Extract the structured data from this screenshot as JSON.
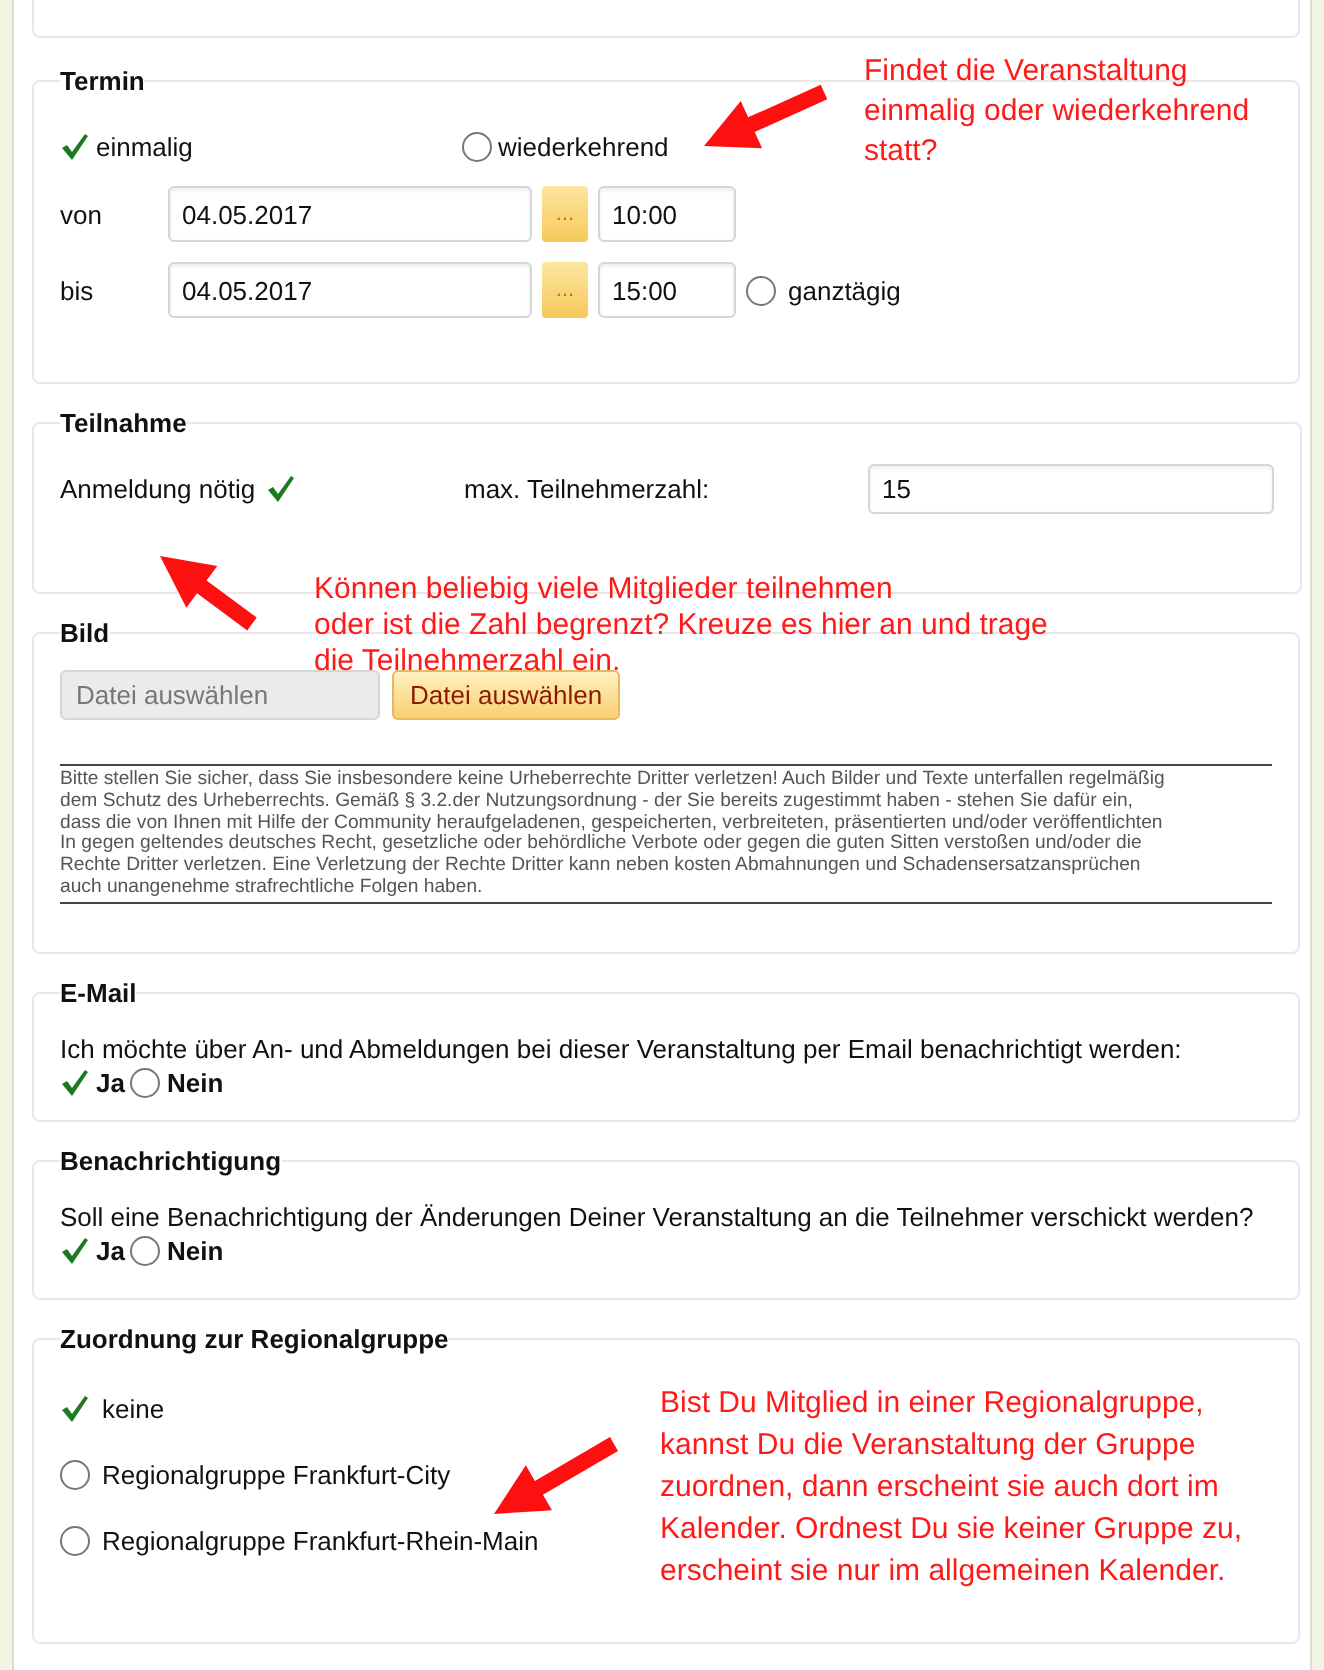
{
  "termin": {
    "title": "Termin",
    "recurrence": [
      {
        "label": "einmalig",
        "selected": true
      },
      {
        "label": "wiederkehrend",
        "selected": false
      }
    ],
    "rows": [
      {
        "label": "von",
        "date": "04.05.2017",
        "picker": "...",
        "time": "10:00"
      },
      {
        "label": "bis",
        "date": "04.05.2017",
        "picker": "...",
        "time": "15:00",
        "all_day": {
          "label": "ganztägig",
          "checked": false
        }
      }
    ]
  },
  "teilnahme": {
    "title": "Teilnahme",
    "registration": {
      "label": "Anmeldung nötig",
      "checked": true
    },
    "max_label": "max. Teilnehmerzahl:",
    "max_value": "15"
  },
  "bild": {
    "title": "Bild",
    "file_field": {
      "placeholder": "Datei auswählen"
    },
    "file_button": "Datei auswählen",
    "disclaimer": [
      "Bitte stellen Sie sicher, dass Sie insbesondere keine Urheberrechte Dritter verletzen! Auch Bilder und Texte unterfallen regelmäßig",
      "dem Schutz des Urheberrechts. Gemäß § 3.2.der Nutzungsordnung - der Sie bereits zugestimmt haben - stehen Sie dafür ein,",
      "dass die von Ihnen mit Hilfe der Community heraufgeladenen, gespeicherten, verbreiteten, präsentierten und/oder veröffentlichten",
      "In gegen geltendes deutsches Recht, gesetzliche oder behördliche Verbote oder gegen die guten Sitten verstoßen und/oder die",
      "Rechte Dritter verletzen. Eine Verletzung der Rechte Dritter kann neben kosten Abmahnungen und Schadensersatzansprüchen",
      "auch unangenehme strafrechtliche Folgen haben."
    ]
  },
  "email": {
    "title": "E-Mail",
    "question": "Ich möchte über An- und Abmeldungen bei dieser Veranstaltung per Email benachrichtigt werden:",
    "choices": [
      {
        "label": "Ja",
        "selected": true
      },
      {
        "label": "Nein",
        "selected": false
      }
    ]
  },
  "benachrichtigung": {
    "title": "Benachrichtigung",
    "question": "Soll eine Benachrichtigung der Änderungen Deiner Veranstaltung an die Teilnehmer verschickt werden?",
    "choices": [
      {
        "label": "Ja",
        "selected": true
      },
      {
        "label": "Nein",
        "selected": false
      }
    ]
  },
  "zuordnung": {
    "title": "Zuordnung zur Regionalgruppe",
    "groups": [
      {
        "label": "keine",
        "selected": true
      },
      {
        "label": "Regionalgruppe Frankfurt-City",
        "selected": false
      },
      {
        "label": "Regionalgruppe Frankfurt-Rhein-Main",
        "selected": false
      }
    ]
  },
  "annotations": [
    {
      "lines": [
        "Findet die Veranstaltung",
        "einmalig oder wiederkehrend",
        "statt?"
      ]
    },
    {
      "lines": [
        "Können beliebig viele Mitglieder teilnehmen",
        "oder ist die Zahl begrenzt? Kreuze es hier an und trage",
        "die Teilnehmerzahl ein."
      ]
    },
    {
      "lines": [
        "Bist Du Mitglied in einer Regionalgruppe,",
        "kannst Du die Veranstaltung der Gruppe",
        "zuordnen, dann erscheint sie auch dort im",
        "Kalender. Ordnest Du sie keiner Gruppe zu,",
        "erscheint sie nur im allgemeinen Kalender."
      ]
    }
  ]
}
